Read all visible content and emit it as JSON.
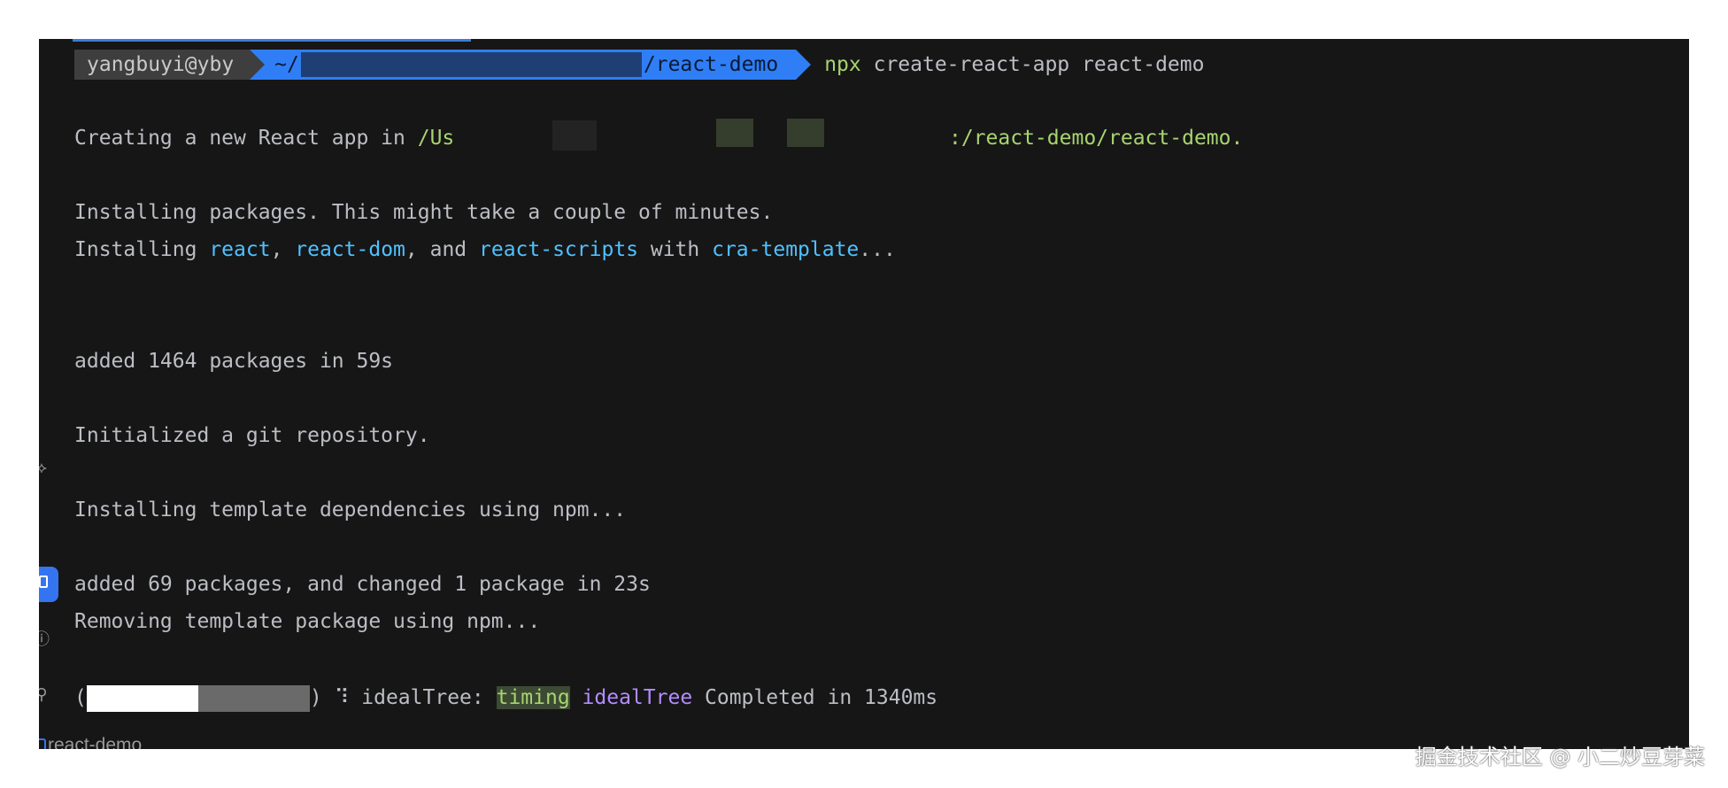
{
  "prompt": {
    "user": "yangbuyi@yby",
    "path_prefix": "~/",
    "path_suffix": "/react-demo",
    "command_bin": "npx",
    "command_args": " create-react-app react-demo"
  },
  "lines": {
    "creating_prefix": "Creating a new React app in ",
    "creating_path_start": "/Us",
    "creating_path_end": ":/react-demo/react-demo.",
    "installing": "Installing packages. This might take a couple of minutes.",
    "installing2_prefix": "Installing ",
    "pkg_react": "react",
    "sep1": ", ",
    "pkg_react_dom": "react-dom",
    "sep2": ", and ",
    "pkg_react_scripts": "react-scripts",
    "with": " with ",
    "pkg_cra_template": "cra-template",
    "ellipsis": "...",
    "added_1464": "added 1464 packages in 59s",
    "git_init": "Initialized a git repository.",
    "template_deps": "Installing template dependencies using npm...",
    "added_69": "added 69 packages, and changed 1 package in 23s",
    "removing": "Removing template package using npm...",
    "progress_open": "(",
    "progress_close": ") ",
    "spinner": "⠹",
    "ideal_label": " idealTree: ",
    "timing": "timing",
    "ideal_tree": "idealTree",
    "completed": " Completed in 1340ms"
  },
  "tab": {
    "label": "react-demo"
  },
  "watermark": "掘金技术社区 @ 小二炒豆芽菜",
  "colors": {
    "background": "#161616",
    "text": "#bcbec4",
    "green": "#a8d46f",
    "cyan": "#4fc1ff",
    "purple": "#b38cff",
    "accent_blue": "#2f7ef5"
  },
  "icons": [
    "git-branch-icon",
    "terminal-icon",
    "problems-icon",
    "vcs-icon"
  ]
}
